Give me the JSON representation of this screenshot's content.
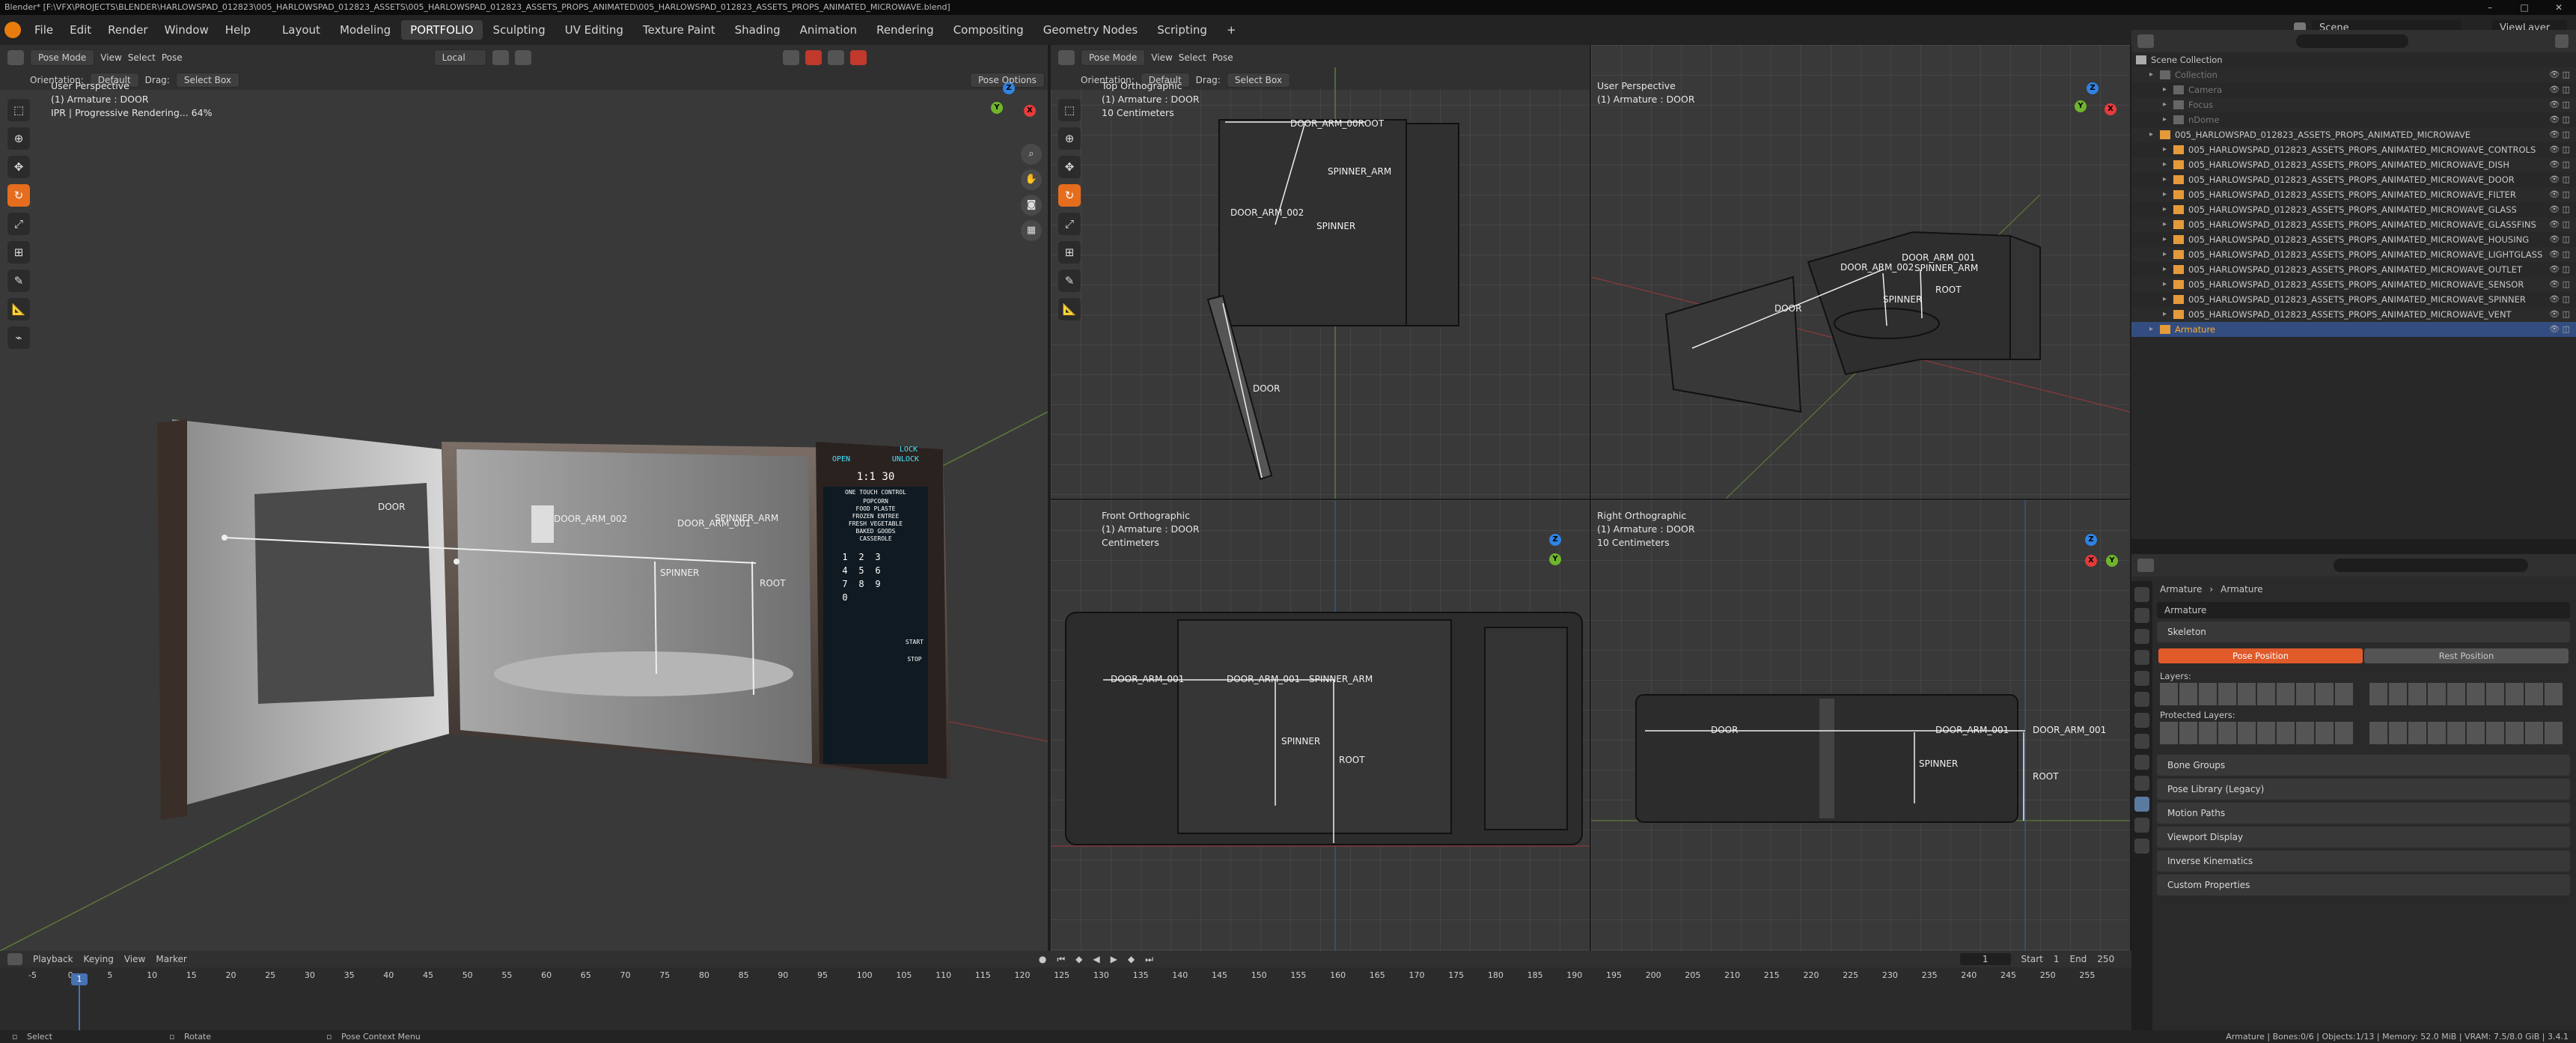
{
  "window": {
    "title": "Blender* [F:\\VFX\\PROJECTS\\BLENDER\\HARLOWSPAD_012823\\005_HARLOWSPAD_012823_ASSETS\\005_HARLOWSPAD_012823_ASSETS_PROPS_ANIMATED\\005_HARLOWSPAD_012823_ASSETS_PROPS_ANIMATED_MICROWAVE.blend]",
    "controls": [
      "–",
      "□",
      "✕"
    ]
  },
  "menu": [
    "File",
    "Edit",
    "Render",
    "Window",
    "Help"
  ],
  "workspaces": [
    "Layout",
    "Modeling",
    "PORTFOLIO",
    "Sculpting",
    "UV Editing",
    "Texture Paint",
    "Shading",
    "Animation",
    "Rendering",
    "Compositing",
    "Geometry Nodes",
    "Scripting"
  ],
  "active_workspace": "PORTFOLIO",
  "scene": {
    "scene_name": "Scene",
    "view_layer": "ViewLayer"
  },
  "viewport_common": {
    "mode": "Pose Mode",
    "menu": [
      "View",
      "Select",
      "Pose"
    ],
    "orientation_label": "Orientation:",
    "orientation": "Default",
    "drag_label": "Drag:",
    "drag": "Select Box",
    "transform": "Local",
    "options": "Pose Options"
  },
  "viewports": {
    "main": {
      "name": "User Perspective",
      "object": "(1) Armature : DOOR",
      "status": "IPR | Progressive Rendering... 64%"
    },
    "top": {
      "name": "Top Orthographic",
      "object": "(1) Armature : DOOR",
      "scale": "10 Centimeters"
    },
    "persp2": {
      "name": "User Perspective",
      "object": "(1) Armature : DOOR"
    },
    "front": {
      "name": "Front Orthographic",
      "object": "(1) Armature : DOOR",
      "scale": "Centimeters"
    },
    "right": {
      "name": "Right Orthographic",
      "object": "(1) Armature : DOOR",
      "scale": "10 Centimeters"
    }
  },
  "bones": {
    "door": "DOOR",
    "door_arm": "DOOR_ARM_002",
    "door_arm1": "DOOR_ARM_001",
    "door_arm_main": "DOOR_ARM_001",
    "spinner_arm": "SPINNER_ARM",
    "spinner": "SPINNER",
    "root": "ROOT",
    "door_arm_top": "DOOR_ARM_00ROOT",
    "door_arm_front": "DOOR_ARM_001",
    "door_arm_front2": "DOOR_ARM_001",
    "door_arm_right": "DOOR_ARM_001",
    "door_arm_persp": "DOOR_ARM_002",
    "main_door_arm2": "DOOR_ARM_002"
  },
  "microwave_panel": {
    "lock": "LOCK",
    "open": "OPEN",
    "unlock": "UNLOCK",
    "time": "1:1 30",
    "heading": "ONE TOUCH CONTROL",
    "presets": [
      "POPCORN",
      "FOOD PLASTE",
      "FROZEN ENTREE",
      "FRESH VEGETABLE",
      "BAKED GOODS",
      "CASSEROLE"
    ],
    "keys": [
      "1",
      "2",
      "3",
      "4",
      "5",
      "6",
      "7",
      "8",
      "9",
      "0"
    ],
    "start": "START",
    "stop": "STOP"
  },
  "outliner": {
    "root": "Scene Collection",
    "rows": [
      {
        "name": "Collection",
        "indent": 1,
        "dim": true
      },
      {
        "name": "Camera",
        "indent": 2,
        "dim": true
      },
      {
        "name": "Focus",
        "indent": 2,
        "dim": true
      },
      {
        "name": "nDome",
        "indent": 2,
        "dim": true
      },
      {
        "name": "005_HARLOWSPAD_012823_ASSETS_PROPS_ANIMATED_MICROWAVE",
        "indent": 1,
        "dim": false
      },
      {
        "name": "005_HARLOWSPAD_012823_ASSETS_PROPS_ANIMATED_MICROWAVE_CONTROLS",
        "indent": 2,
        "dim": false
      },
      {
        "name": "005_HARLOWSPAD_012823_ASSETS_PROPS_ANIMATED_MICROWAVE_DISH",
        "indent": 2,
        "dim": false
      },
      {
        "name": "005_HARLOWSPAD_012823_ASSETS_PROPS_ANIMATED_MICROWAVE_DOOR",
        "indent": 2,
        "dim": false
      },
      {
        "name": "005_HARLOWSPAD_012823_ASSETS_PROPS_ANIMATED_MICROWAVE_FILTER",
        "indent": 2,
        "dim": false
      },
      {
        "name": "005_HARLOWSPAD_012823_ASSETS_PROPS_ANIMATED_MICROWAVE_GLASS",
        "indent": 2,
        "dim": false
      },
      {
        "name": "005_HARLOWSPAD_012823_ASSETS_PROPS_ANIMATED_MICROWAVE_GLASSFINS",
        "indent": 2,
        "dim": false
      },
      {
        "name": "005_HARLOWSPAD_012823_ASSETS_PROPS_ANIMATED_MICROWAVE_HOUSING",
        "indent": 2,
        "dim": false
      },
      {
        "name": "005_HARLOWSPAD_012823_ASSETS_PROPS_ANIMATED_MICROWAVE_LIGHTGLASS",
        "indent": 2,
        "dim": false
      },
      {
        "name": "005_HARLOWSPAD_012823_ASSETS_PROPS_ANIMATED_MICROWAVE_OUTLET",
        "indent": 2,
        "dim": false
      },
      {
        "name": "005_HARLOWSPAD_012823_ASSETS_PROPS_ANIMATED_MICROWAVE_SENSOR",
        "indent": 2,
        "dim": false
      },
      {
        "name": "005_HARLOWSPAD_012823_ASSETS_PROPS_ANIMATED_MICROWAVE_SPINNER",
        "indent": 2,
        "dim": false
      },
      {
        "name": "005_HARLOWSPAD_012823_ASSETS_PROPS_ANIMATED_MICROWAVE_VENT",
        "indent": 2,
        "dim": false
      },
      {
        "name": "Armature",
        "indent": 1,
        "dim": false,
        "selected": true
      }
    ]
  },
  "properties": {
    "breadcrumb_obj": "Armature",
    "breadcrumb_data": "Armature",
    "data_name": "Armature",
    "skeleton": "Skeleton",
    "pose_position": "Pose Position",
    "rest_position": "Rest Position",
    "layers": "Layers:",
    "protected_layers": "Protected Layers:",
    "sections": [
      "Bone Groups",
      "Pose Library (Legacy)",
      "Motion Paths",
      "Viewport Display",
      "Inverse Kinematics",
      "Custom Properties"
    ]
  },
  "timeline": {
    "menu": [
      "Playback",
      "Keying",
      "View",
      "Marker"
    ],
    "current_frame": "1",
    "start_label": "Start",
    "start": "1",
    "end_label": "End",
    "end": "250",
    "ticks": [
      "-5",
      "0",
      "5",
      "10",
      "15",
      "20",
      "25",
      "30",
      "35",
      "40",
      "45",
      "50",
      "55",
      "60",
      "65",
      "70",
      "75",
      "80",
      "85",
      "90",
      "95",
      "100",
      "105",
      "110",
      "115",
      "120",
      "125",
      "130",
      "135",
      "140",
      "145",
      "150",
      "155",
      "160",
      "165",
      "170",
      "175",
      "180",
      "185",
      "190",
      "195",
      "200",
      "205",
      "210",
      "215",
      "220",
      "225",
      "230",
      "235",
      "240",
      "245",
      "250",
      "255"
    ],
    "playhead": "1"
  },
  "status": {
    "select": "Select",
    "rotate": "Rotate",
    "context": "Pose Context Menu",
    "right": "Armature | Bones:0/6 | Objects:1/13 | Memory: 52.0 MiB | VRAM: 7.5/8.0 GiB | 3.4.1"
  },
  "colors": {
    "accent": "#e56d1d",
    "selected_row": "#ffaf29",
    "panel": "#393939"
  }
}
